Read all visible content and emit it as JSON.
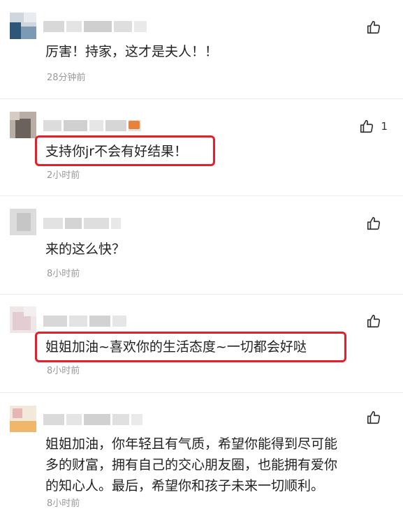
{
  "comments": [
    {
      "text": "厉害！持家，这才是夫人！！",
      "time": "28分钟前",
      "likes": ""
    },
    {
      "text": "支持你jr不会有好结果！",
      "time": "2小时前",
      "likes": "1"
    },
    {
      "text": "来的这么快？",
      "time": "8小时前",
      "likes": ""
    },
    {
      "text": "姐姐加油~喜欢你的生活态度~一切都会好哒",
      "time": "8小时前",
      "likes": ""
    },
    {
      "lines": [
        "姐姐加油，你年轻且有气质，希望你能得到尽可能",
        "多的财富，拥有自己的交心朋友圈，也能拥有爱你",
        "的知心人。最后，希望你和孩子未来一切顺利。"
      ],
      "time": "8小时前",
      "likes": ""
    }
  ],
  "colors": {
    "highlight": "#e3202a",
    "time": "#9a9a9a"
  },
  "icons": {
    "like": "thumbs-up-icon"
  }
}
